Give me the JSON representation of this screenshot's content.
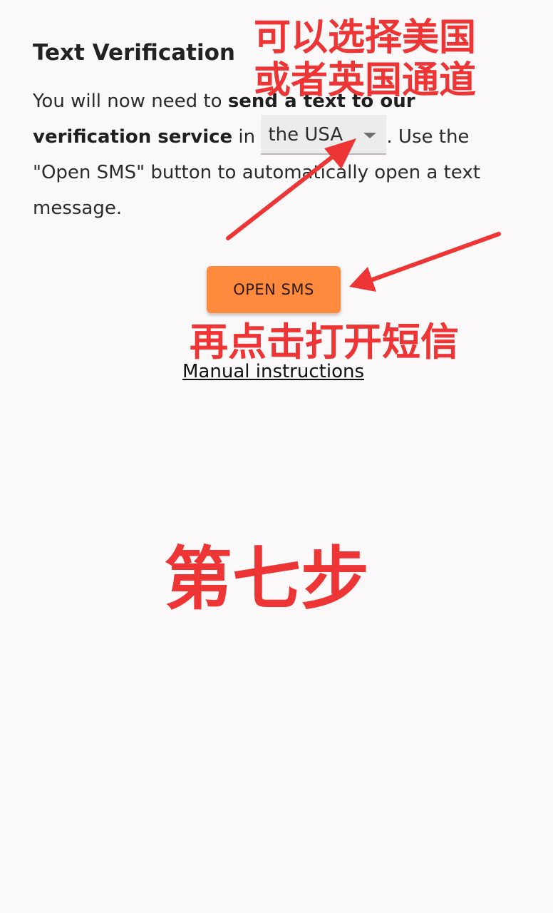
{
  "header": {
    "title": "Text Verification"
  },
  "instructions": {
    "part1": "You will now need to ",
    "bold": "send a text to our verification service",
    "part2": " in ",
    "part3": ". Use the \"Open SMS\" button to automatically open a text message."
  },
  "country_select": {
    "selected": "the USA"
  },
  "buttons": {
    "open_sms": "OPEN SMS"
  },
  "links": {
    "manual": "Manual instructions"
  },
  "annotations": {
    "select_hint_line1": "可以选择美国",
    "select_hint_line2": "或者英国通道",
    "button_hint": "再点击打开短信",
    "step": "第七步"
  },
  "colors": {
    "background": "#faf8f9",
    "button": "#ff8a3d",
    "annotation": "#ee3535"
  },
  "icons": {
    "select_caret": "chevron-down-icon",
    "arrows": "red-arrow"
  }
}
